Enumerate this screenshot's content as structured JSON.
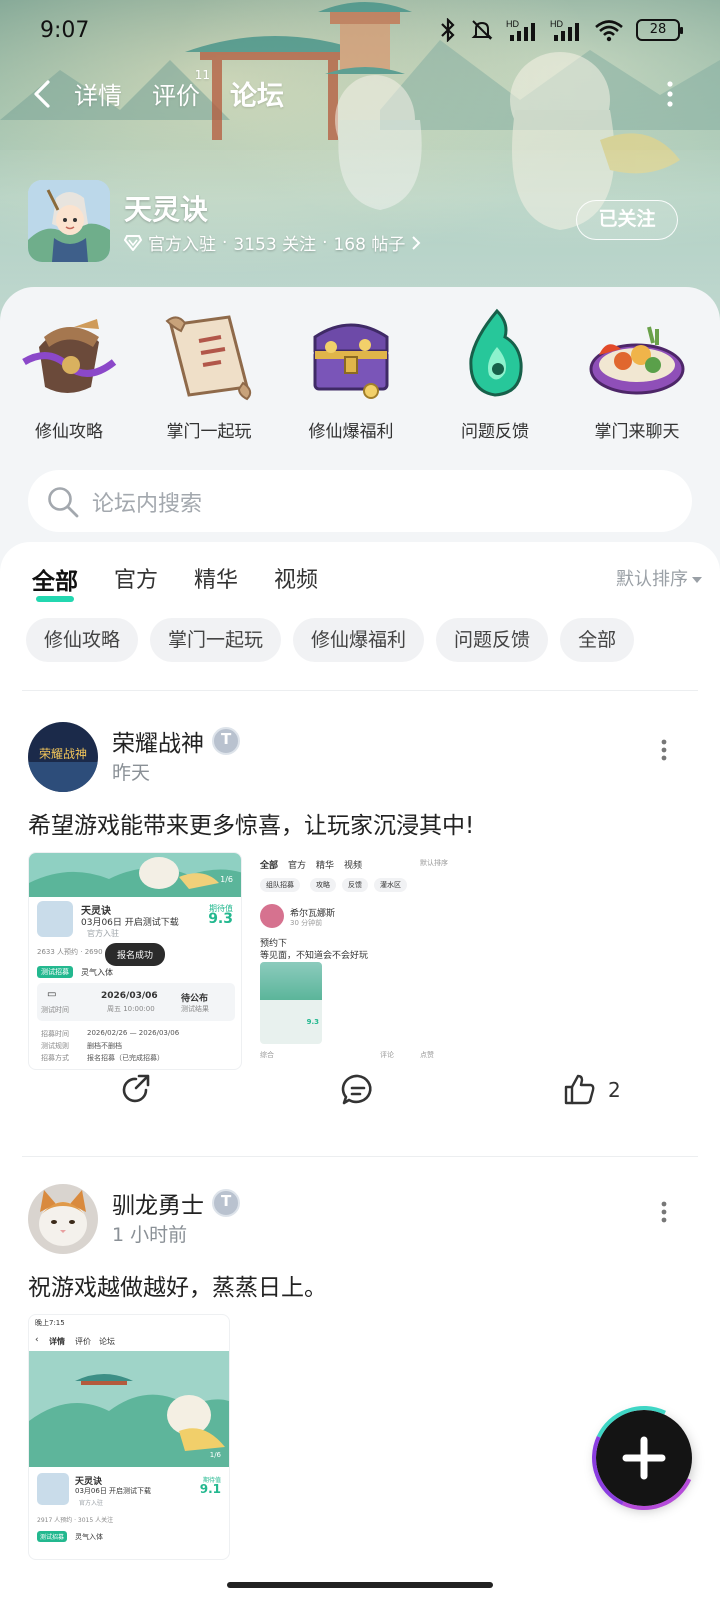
{
  "status_bar": {
    "time": "9:07",
    "battery": "28",
    "icons": [
      "bluetooth-icon",
      "mute-icon",
      "hd-signal-icon",
      "hd-signal-icon",
      "wifi-icon",
      "battery-icon"
    ]
  },
  "nav": {
    "tabs": [
      {
        "label": "详情"
      },
      {
        "label": "评价",
        "badge": "11"
      },
      {
        "label": "论坛"
      }
    ],
    "active_tab": "论坛"
  },
  "forum": {
    "name": "天灵诀",
    "verified": "官方入驻",
    "followers": "3153 关注",
    "posts": "168 帖子",
    "sep": "·",
    "follow_label": "已关注"
  },
  "categories": [
    {
      "label": "修仙攻略",
      "icon": "guide-bag-icon"
    },
    {
      "label": "掌门一起玩",
      "icon": "scroll-icon"
    },
    {
      "label": "修仙爆福利",
      "icon": "treasure-chest-icon"
    },
    {
      "label": "问题反馈",
      "icon": "green-flame-icon"
    },
    {
      "label": "掌门来聊天",
      "icon": "food-plate-icon"
    }
  ],
  "search": {
    "placeholder": "论坛内搜索"
  },
  "feed": {
    "tabs": [
      "全部",
      "官方",
      "精华",
      "视频"
    ],
    "active_tab": "全部",
    "sort_label": "默认排序",
    "chips": [
      "修仙攻略",
      "掌门一起玩",
      "修仙爆福利",
      "问题反馈",
      "全部"
    ]
  },
  "posts": [
    {
      "author": "荣耀战神",
      "avatar_text": "荣耀战神",
      "time": "昨天",
      "text": "希望游戏能带来更多惊喜，让玩家沉浸其中!",
      "likes": "2",
      "thumb1": {
        "page": "1/6",
        "game": "天灵诀",
        "date_line": "03月06日 开启测试下载",
        "official": "官方入驻",
        "score_label": "期待值",
        "score": "9.3",
        "stats": "2633 人预约 · 2690 人关注",
        "toast": "报名成功",
        "tag": "测试招募",
        "tag_text": "灵气入体",
        "date": "2026/03/06",
        "date_sub": "测试时间",
        "time_sub": "周五 10:00:00",
        "pending": "待公布",
        "pending_sub": "测试结果",
        "rows": [
          [
            "招募时间",
            "2026/02/26 — 2026/03/06"
          ],
          [
            "测试规则",
            "删档不删档"
          ],
          [
            "招募方式",
            "报名招募（已完成招募）"
          ]
        ]
      },
      "thumb2": {
        "tabs": [
          "全部",
          "官方",
          "精华",
          "视频"
        ],
        "sort": "默认排序",
        "chips": [
          "组队招募",
          "攻略",
          "反馈",
          "灌水区"
        ],
        "user": "希尔瓦娜斯",
        "time": "30 分钟前",
        "line1": "预约下",
        "line2": "等见面，不知道会不会好玩",
        "score": "9.3",
        "footer": "综合",
        "comment": "评论",
        "like": "点赞"
      }
    },
    {
      "author": "驯龙勇士",
      "time": "1 小时前",
      "text": "祝游戏越做越好，蒸蒸日上。",
      "thumb": {
        "status_time": "晚上7:15",
        "tabs": [
          "详情",
          "评价",
          "论坛"
        ],
        "page": "1/6",
        "game": "天灵诀",
        "date_line": "03月06日 开启测试下载",
        "official": "官方入驻",
        "score_label": "期待值",
        "score": "9.1",
        "stats": "2917 人预约 · 3015 人关注",
        "tag": "测试招募",
        "tag_text": "灵气入体"
      }
    }
  ],
  "colors": {
    "accent": "#23d7b0",
    "hero_top": "#6f9c8f",
    "panel_bg": "#f3f5f7",
    "muted_text": "#8a9096"
  }
}
